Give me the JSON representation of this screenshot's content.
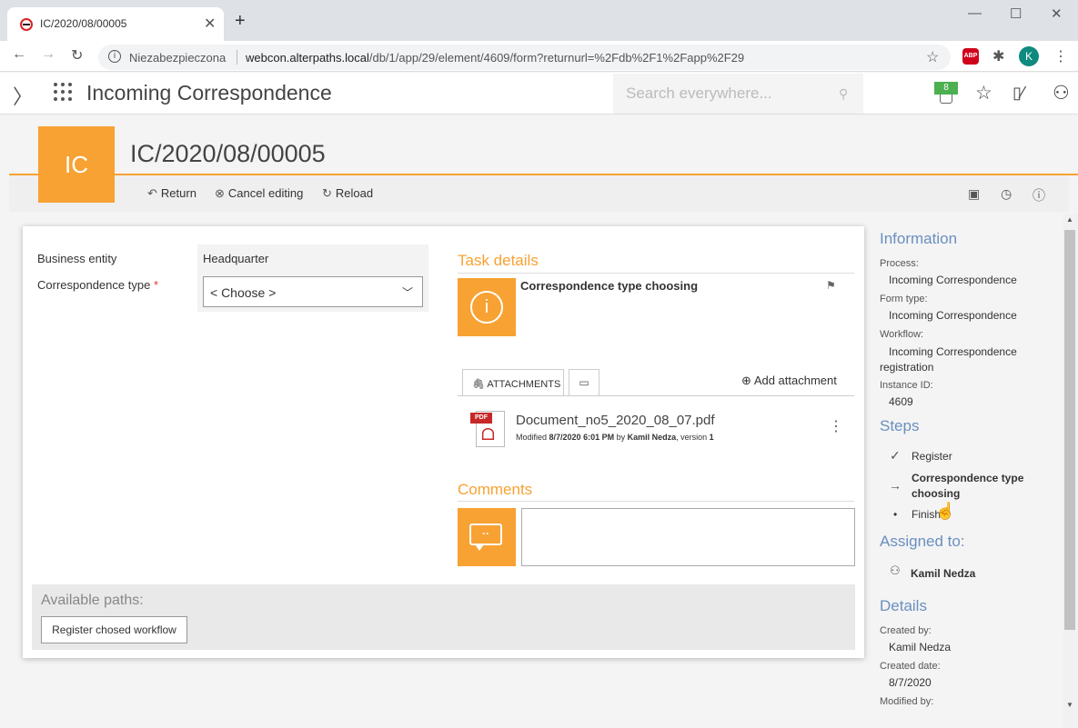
{
  "browser": {
    "tab_title": "IC/2020/08/00005",
    "new_tab": "+",
    "not_secure": "Niezabezpieczona",
    "url_host": "webcon.alterpaths.local",
    "url_path": "/db/1/app/29/element/4609/form?returnurl=%2Fdb%2F1%2Fapp%2F29",
    "abp_label": "ABP",
    "profile_initial": "K"
  },
  "header": {
    "app_title": "Incoming Correspondence",
    "search_placeholder": "Search everywhere...",
    "notifications_count": "8"
  },
  "element": {
    "icon_text": "IC",
    "title": "IC/2020/08/00005"
  },
  "toolbar": {
    "return_label": "Return",
    "cancel_label": "Cancel editing",
    "reload_label": "Reload"
  },
  "form": {
    "business_entity_label": "Business entity",
    "business_entity_value": "Headquarter",
    "corr_type_label": "Correspondence type",
    "required_mark": "*",
    "corr_type_value": "< Choose >"
  },
  "task": {
    "section_title": "Task details",
    "task_name": "Correspondence type choosing"
  },
  "attachments": {
    "tab_label": "ATTACHMENTS",
    "add_label": "Add attachment",
    "items": [
      {
        "name": "Document_no5_2020_08_07.pdf",
        "meta_prefix": "Modified ",
        "date": "8/7/2020 6:01 PM",
        "by": " by ",
        "author": "Kamil Nedza",
        "version_prefix": ", version ",
        "version": "1"
      }
    ]
  },
  "comments": {
    "section_title": "Comments"
  },
  "paths": {
    "title": "Available paths:",
    "buttons": [
      "Register chosed workflow"
    ]
  },
  "info": {
    "title": "Information",
    "process_label": "Process:",
    "process_value": "Incoming Correspondence",
    "form_type_label": "Form type:",
    "form_type_value": "Incoming Correspondence",
    "workflow_label": "Workflow:",
    "workflow_value": "Incoming Correspondence registration",
    "instance_label": "Instance ID:",
    "instance_value": "4609"
  },
  "steps": {
    "title": "Steps",
    "items": [
      {
        "label": "Register",
        "state": "done"
      },
      {
        "label": "Correspondence type choosing",
        "state": "current"
      },
      {
        "label": "Finish",
        "state": "pending"
      }
    ]
  },
  "assigned": {
    "title": "Assigned to:",
    "user": "Kamil Nedza"
  },
  "details": {
    "title": "Details",
    "created_by_label": "Created by:",
    "created_by_value": "Kamil Nedza",
    "created_date_label": "Created date:",
    "created_date_value": "8/7/2020",
    "modified_by_label": "Modified by:"
  }
}
